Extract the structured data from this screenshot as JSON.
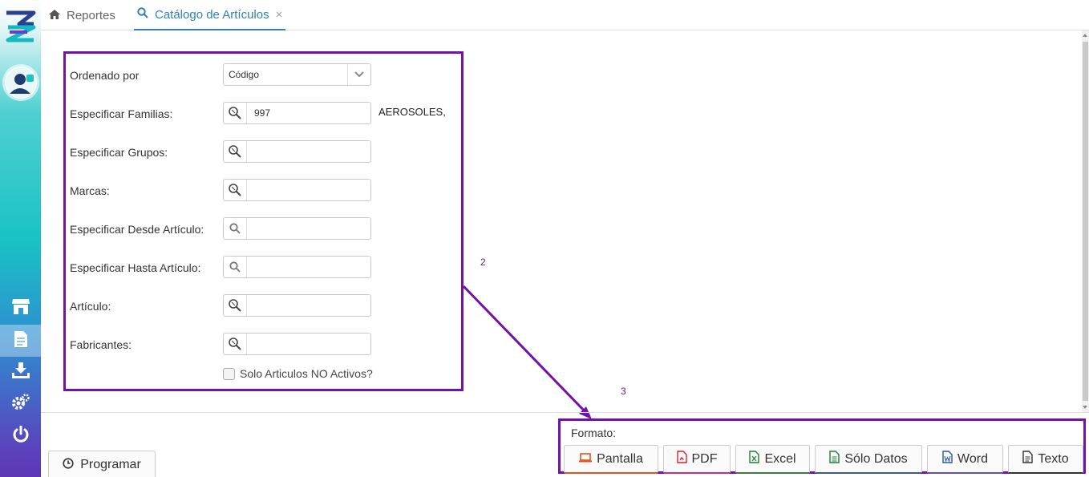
{
  "tabs": [
    {
      "label": "Reportes",
      "icon": "home-icon"
    },
    {
      "label": "Catálogo de Artículos",
      "icon": "search-icon",
      "close": "×"
    }
  ],
  "form": {
    "ordenado_por": {
      "label": "Ordenado por",
      "value": "Código"
    },
    "familias": {
      "label": "Especificar Familias:",
      "value": "997",
      "description": "AEROSOLES,"
    },
    "grupos": {
      "label": "Especificar Grupos:",
      "value": ""
    },
    "marcas": {
      "label": "Marcas:",
      "value": ""
    },
    "desde_articulo": {
      "label": "Especificar Desde Artículo:",
      "value": ""
    },
    "hasta_articulo": {
      "label": "Especificar Hasta Artículo:",
      "value": ""
    },
    "articulo": {
      "label": "Artículo:",
      "value": ""
    },
    "fabricantes": {
      "label": "Fabricantes:",
      "value": ""
    },
    "solo_no_activos": {
      "label": "Solo Articulos NO Activos?",
      "checked": false
    }
  },
  "annotations": {
    "box2": "2",
    "box3": "3",
    "color": "#7212a8"
  },
  "bottom": {
    "programar": "Programar",
    "format_label": "Formato:",
    "formats": [
      {
        "label": "Pantalla",
        "icon": "laptop-icon",
        "color": "#e8501d"
      },
      {
        "label": "PDF",
        "icon": "pdf-file-icon",
        "color": "#d9232d"
      },
      {
        "label": "Excel",
        "icon": "excel-file-icon",
        "color": "#1e7e34"
      },
      {
        "label": "Sólo Datos",
        "icon": "data-file-icon",
        "color": "#1e7e34"
      },
      {
        "label": "Word",
        "icon": "word-file-icon",
        "color": "#2b579a"
      },
      {
        "label": "Texto",
        "icon": "text-file-icon",
        "color": "#333333"
      }
    ]
  },
  "sidebar": {
    "items": [
      {
        "icon": "store-icon"
      },
      {
        "icon": "report-document-icon",
        "active": true
      },
      {
        "icon": "download-tray-icon"
      },
      {
        "icon": "settings-gears-icon"
      },
      {
        "icon": "power-icon"
      }
    ]
  }
}
